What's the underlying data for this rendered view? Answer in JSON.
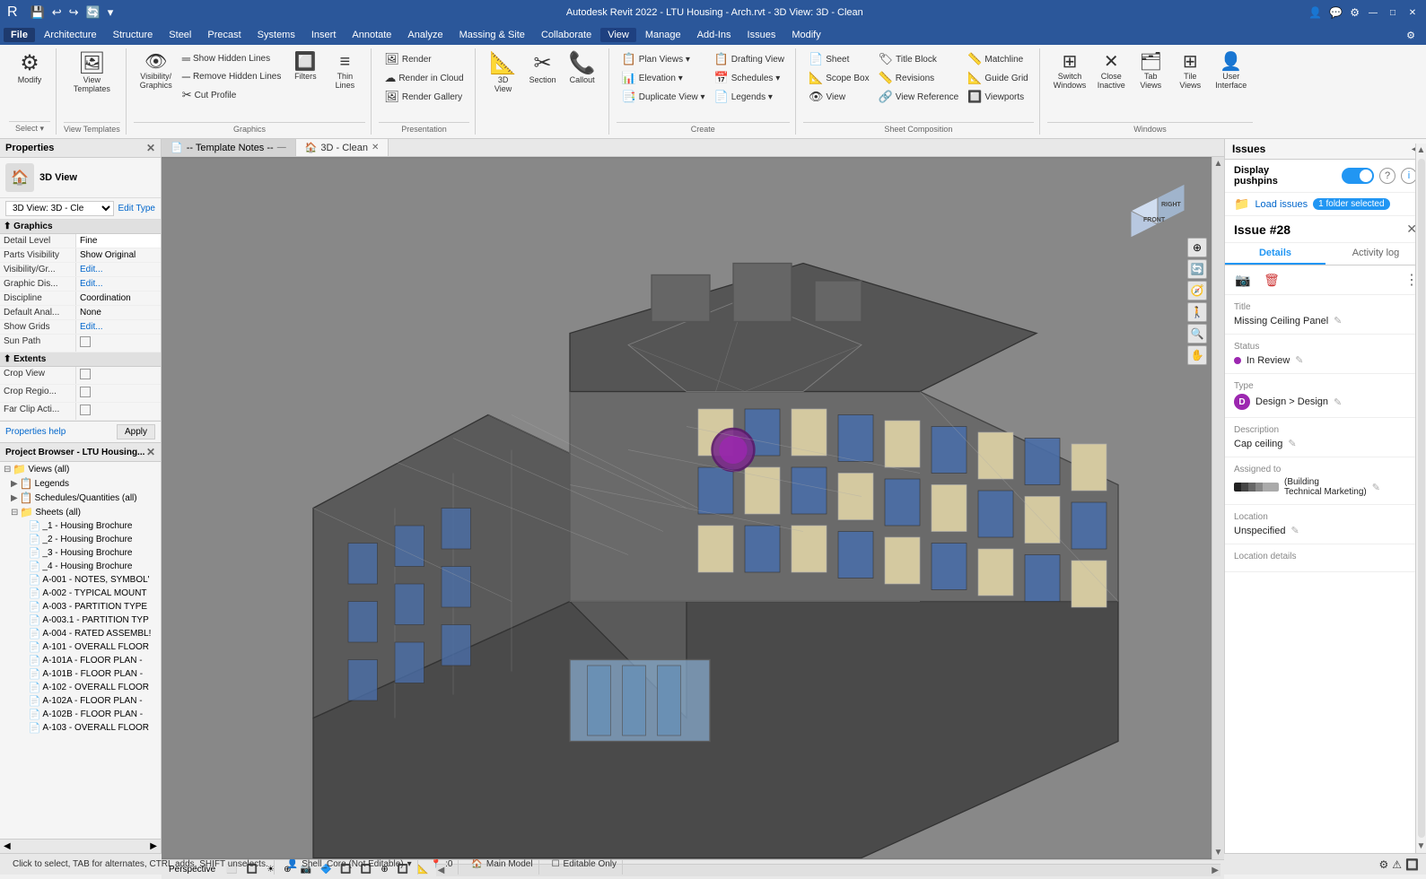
{
  "titlebar": {
    "title": "Autodesk Revit 2022 - LTU Housing - Arch.rvt - 3D View: 3D - Clean",
    "min": "—",
    "max": "□",
    "close": "✕"
  },
  "menubar": {
    "items": [
      "File",
      "Architecture",
      "Structure",
      "Steel",
      "Precast",
      "Systems",
      "Insert",
      "Annotate",
      "Analyze",
      "Massing & Site",
      "Collaborate",
      "View",
      "Manage",
      "Add-Ins",
      "Issues",
      "Modify"
    ],
    "active": "View"
  },
  "ribbon": {
    "groups": [
      {
        "label": "Select",
        "items_large": [
          {
            "icon": "⚙",
            "text": "Modify"
          }
        ],
        "items_small": []
      },
      {
        "label": "View Templates",
        "items_large": [
          {
            "icon": "🪟",
            "text": "View\nTemplates"
          }
        ],
        "items_small": []
      },
      {
        "label": "Graphics",
        "items_large": [
          {
            "icon": "👁",
            "text": "Visibility/\nGraphics"
          },
          {
            "icon": "🔲",
            "text": "Filters"
          },
          {
            "icon": "≡",
            "text": "Thin\nLines"
          }
        ],
        "items_small": [
          {
            "icon": "—",
            "text": "Show Hidden Lines"
          },
          {
            "icon": "—",
            "text": "Remove Hidden Lines"
          },
          {
            "icon": "✂",
            "text": "Cut Profile"
          }
        ]
      },
      {
        "label": "Presentation",
        "items_small": [
          {
            "icon": "🖼",
            "text": "Render"
          },
          {
            "icon": "🏔",
            "text": "Render in Cloud"
          },
          {
            "icon": "🖼",
            "text": "Render Gallery"
          }
        ]
      },
      {
        "label": "",
        "items_large": [
          {
            "icon": "📐",
            "text": "3D\nView"
          },
          {
            "icon": "✂",
            "text": "Section"
          },
          {
            "icon": "📞",
            "text": "Callout"
          }
        ]
      },
      {
        "label": "Create",
        "items_small": [
          {
            "icon": "📋",
            "text": "Plan Views ▾"
          },
          {
            "icon": "📊",
            "text": "Elevation ▾"
          },
          {
            "icon": "📑",
            "text": "Duplicate View ▾"
          },
          {
            "icon": "📋",
            "text": "Drafting View"
          },
          {
            "icon": "📅",
            "text": "Schedules ▾"
          },
          {
            "icon": "📄",
            "text": "Legends ▾"
          }
        ]
      },
      {
        "label": "Sheet Composition",
        "items_small": [
          {
            "icon": "📄",
            "text": "Sheet"
          },
          {
            "icon": "📐",
            "text": "Scope Box"
          },
          {
            "icon": "👁",
            "text": "View"
          },
          {
            "icon": "🏷",
            "text": "Title Block"
          },
          {
            "icon": "📏",
            "text": "Revisions"
          },
          {
            "icon": "🔗",
            "text": "View Reference"
          },
          {
            "icon": "📏",
            "text": "Matchline"
          },
          {
            "icon": "📐",
            "text": "Guide Grid"
          },
          {
            "icon": "🔲",
            "text": "Viewports"
          }
        ]
      },
      {
        "label": "Windows",
        "items_large": [
          {
            "icon": "⊞",
            "text": "Switch\nWindows"
          },
          {
            "icon": "✕",
            "text": "Close\nInactive"
          },
          {
            "icon": "🔲",
            "text": "Tab\nViews"
          },
          {
            "icon": "🔲",
            "text": "Tile\nViews"
          }
        ],
        "items_small": [
          {
            "icon": "👤",
            "text": "User\nInterface"
          }
        ]
      }
    ]
  },
  "left_panel": {
    "title": "Properties",
    "view_icon": "🏠",
    "view_name": "3D View",
    "type_selector": "3D View: 3D - Cle",
    "edit_type": "Edit Type",
    "sections": [
      {
        "label": "Graphics",
        "rows": [
          {
            "label": "Detail Level",
            "value": "Fine",
            "editable": true
          },
          {
            "label": "Parts Visibility",
            "value": "Show Original",
            "editable": false
          },
          {
            "label": "Visibility/Gr...",
            "value": "Edit...",
            "link": true
          },
          {
            "label": "Graphic Dis...",
            "value": "Edit...",
            "link": true
          },
          {
            "label": "Discipline",
            "value": "Coordination",
            "editable": false
          },
          {
            "label": "Default Anal...",
            "value": "None",
            "editable": false
          },
          {
            "label": "Show Grids",
            "value": "Edit...",
            "link": true
          },
          {
            "label": "Sun Path",
            "value": "",
            "checkbox": true
          }
        ]
      },
      {
        "label": "Extents",
        "rows": [
          {
            "label": "Crop View",
            "value": "",
            "checkbox": true
          },
          {
            "label": "Crop Regio...",
            "value": "",
            "checkbox": true
          },
          {
            "label": "Far Clip Acti...",
            "value": "",
            "checkbox": true
          }
        ]
      }
    ],
    "help_link": "Properties help",
    "apply_label": "Apply"
  },
  "project_browser": {
    "title": "Project Browser - LTU Housing...",
    "items": [
      {
        "label": "Views (all)",
        "indent": 0,
        "expanded": true,
        "icon": "📁"
      },
      {
        "label": "Legends",
        "indent": 1,
        "icon": "📋"
      },
      {
        "label": "Schedules/Quantities (all)",
        "indent": 1,
        "icon": "📋"
      },
      {
        "label": "Sheets (all)",
        "indent": 1,
        "expanded": true,
        "icon": "📁"
      },
      {
        "label": "_1 - Housing Brochure",
        "indent": 2,
        "icon": "📄"
      },
      {
        "label": "_2 - Housing Brochure",
        "indent": 2,
        "icon": "📄"
      },
      {
        "label": "_3 - Housing Brochure",
        "indent": 2,
        "icon": "📄"
      },
      {
        "label": "_4 - Housing Brochure",
        "indent": 2,
        "icon": "📄"
      },
      {
        "label": "A-001 - NOTES, SYMBOL'",
        "indent": 2,
        "icon": "📄"
      },
      {
        "label": "A-002 - TYPICAL MOUNT",
        "indent": 2,
        "icon": "📄"
      },
      {
        "label": "A-003 - PARTITION TYPE",
        "indent": 2,
        "icon": "📄"
      },
      {
        "label": "A-003.1 - PARTITION TYP",
        "indent": 2,
        "icon": "📄"
      },
      {
        "label": "A-004 - RATED ASSEMBL!",
        "indent": 2,
        "icon": "📄"
      },
      {
        "label": "A-101 - OVERALL FLOOR",
        "indent": 2,
        "icon": "📄"
      },
      {
        "label": "A-101A - FLOOR PLAN -",
        "indent": 2,
        "icon": "📄"
      },
      {
        "label": "A-101B - FLOOR PLAN -",
        "indent": 2,
        "icon": "📄"
      },
      {
        "label": "A-102 - OVERALL FLOOR",
        "indent": 2,
        "icon": "📄"
      },
      {
        "label": "A-102A - FLOOR PLAN -",
        "indent": 2,
        "icon": "📄"
      },
      {
        "label": "A-102B - FLOOR PLAN -",
        "indent": 2,
        "icon": "📄"
      },
      {
        "label": "A-103 - OVERALL FLOOR",
        "indent": 2,
        "icon": "📄"
      }
    ]
  },
  "viewport": {
    "tabs": [
      {
        "label": "-- Template Notes --",
        "icon": "📄",
        "active": false
      },
      {
        "label": "3D - Clean",
        "icon": "🏠",
        "active": true
      }
    ],
    "view_type_label": "Perspective",
    "bottom_controls": [
      "Perspective",
      "⬜",
      "🔲",
      "🎯",
      "⊕",
      "📷",
      "🔷",
      "🔲",
      "🔲",
      "⊕",
      "🔲",
      "📐"
    ]
  },
  "cube": {
    "front_label": "FRONT",
    "right_label": "RIGHT"
  },
  "issues_panel": {
    "title": "Issues",
    "toggle_label": "Display\npushpins",
    "toggle_state": true,
    "help_icon": "?",
    "info_icon": "i",
    "folder_label": "Load issues",
    "folder_badge": "1 folder selected",
    "issue": {
      "number": "Issue #28",
      "tabs": [
        "Details",
        "Activity log"
      ],
      "active_tab": "Details",
      "actions": {
        "camera": "📷",
        "delete": "🗑",
        "more": "⋮"
      },
      "fields": [
        {
          "label": "Title",
          "value": "Missing Ceiling Panel",
          "editable": true
        },
        {
          "label": "Status",
          "value": "In Review",
          "status_color": "#9c27b0",
          "editable": true
        },
        {
          "label": "Type",
          "value": "Design > Design",
          "type_badge": "D",
          "editable": true
        },
        {
          "label": "Description",
          "value": "Cap ceiling",
          "editable": true
        },
        {
          "label": "Assigned to",
          "value": "(Building\nTechnical Marketing)",
          "has_avatar": true,
          "editable": true
        },
        {
          "label": "Location",
          "value": "Unspecified",
          "editable": true
        },
        {
          "label": "Location details",
          "value": "",
          "editable": false
        }
      ]
    }
  },
  "statusbar": {
    "message": "Click to select, TAB for alternates, CTRL adds, SHIFT unselects.",
    "workset": "Shell_Core (Not Editable)",
    "coordinates": ":0",
    "active_only": "",
    "design_options": "Main Model",
    "items": [
      {
        "text": "Click to select, TAB for alternates, CTRL adds, SHIFT unselects."
      },
      {
        "text": "Shell_Core (Not Editable)"
      },
      {
        "text": ":0"
      },
      {
        "text": "Main Model"
      },
      {
        "text": "Editable Only"
      }
    ]
  }
}
